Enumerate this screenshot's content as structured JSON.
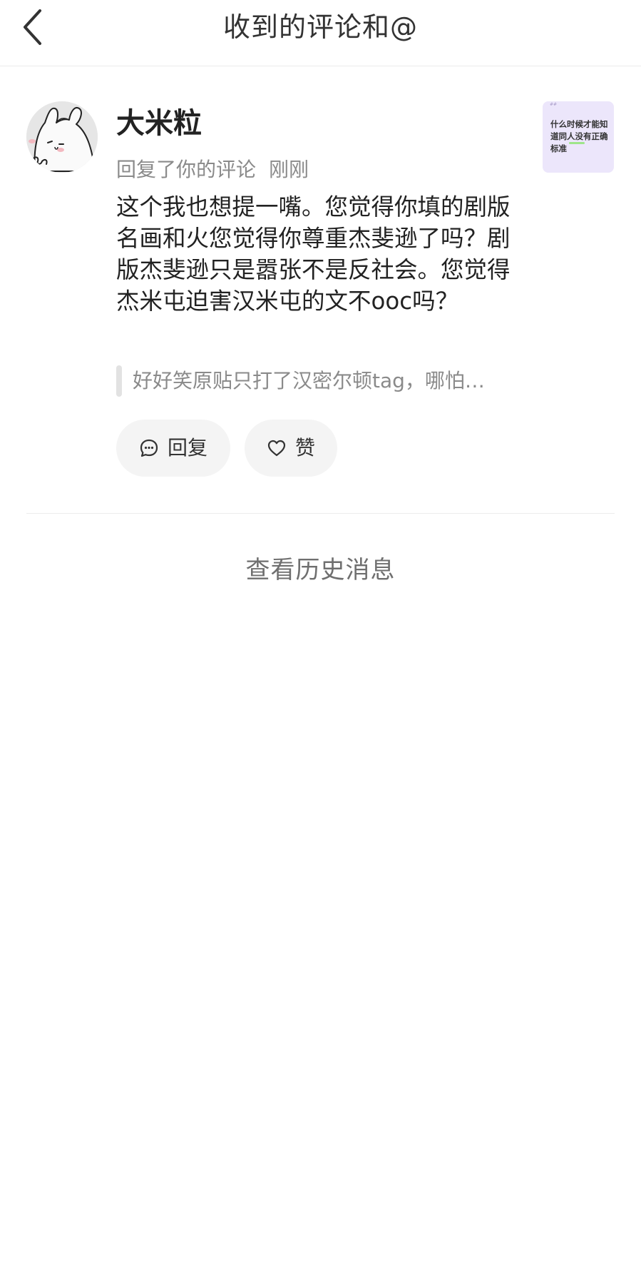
{
  "header": {
    "title": "收到的评论和@",
    "back_icon": "chevron-left-icon"
  },
  "notification": {
    "username": "大米粒",
    "action": "回复了你的评论",
    "time": "刚刚",
    "comment": "这个我也想提一嘴。您觉得你填的剧版名画和火您觉得你尊重杰斐逊了吗？剧版杰斐逊只是嚣张不是反社会。您觉得杰米屯迫害汉米屯的文不ooc吗？",
    "quoted": "好好笑原贴只打了汉密尔顿tag，哪怕…",
    "reply_label": "回复",
    "like_label": "赞",
    "reply_icon": "comment-bubble-icon",
    "like_icon": "heart-icon",
    "thumbnail": {
      "top_text": "##",
      "text": "什么时候才能知道同人没有正确标准",
      "background": "#ece6fb"
    }
  },
  "footer": {
    "history_label": "查看历史消息"
  },
  "colors": {
    "text_primary": "#222222",
    "text_secondary": "#8a8a8a",
    "pill_bg": "#f4f4f4",
    "divider": "#ececec"
  }
}
